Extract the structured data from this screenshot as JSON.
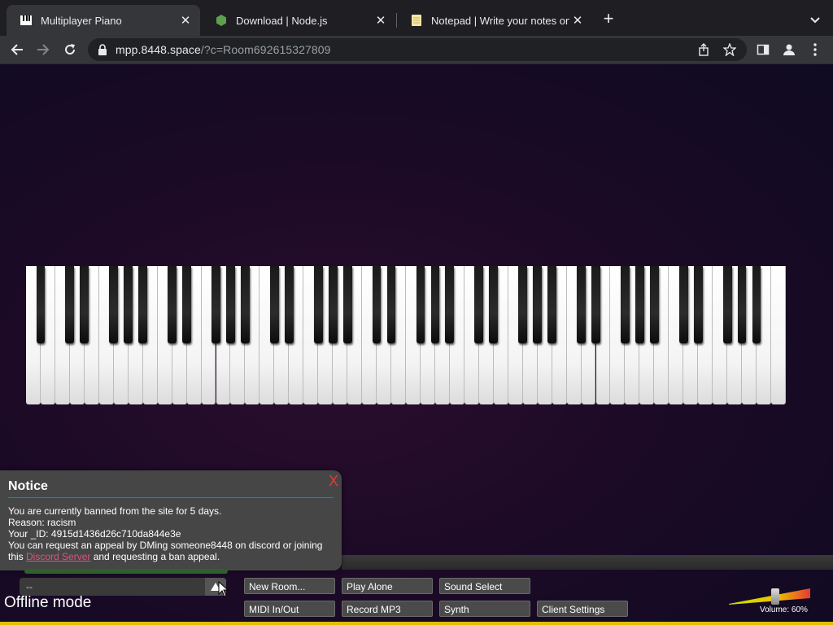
{
  "browser": {
    "tabs": [
      {
        "title": "Multiplayer Piano",
        "icon": "piano-icon",
        "active": true
      },
      {
        "title": "Download | Node.js",
        "icon": "nodejs-icon",
        "active": false
      },
      {
        "title": "Notepad | Write your notes onli",
        "icon": "notepad-icon",
        "active": false
      }
    ],
    "url_host": "mpp.8448.space",
    "url_path": "/?c=Room692615327809"
  },
  "notice": {
    "title": "Notice",
    "close": "X",
    "line1": "You are currently banned from the site for 5 days.",
    "line2": "Reason: racism",
    "line3": "Your _ID: 4915d1436d26c710da844e3e",
    "line4": "You can request an appeal by DMing someone8448 on discord or joining",
    "line5_prefix": "this ",
    "line5_link": "Discord Server",
    "line5_suffix": " and requesting a ban appeal."
  },
  "chat": {
    "value": "--"
  },
  "status": {
    "offline": "Offline mode"
  },
  "buttons": {
    "new_room": "New Room...",
    "play_alone": "Play Alone",
    "sound_select": "Sound Select",
    "midi": "MIDI In/Out",
    "record": "Record MP3",
    "synth": "Synth",
    "client_settings": "Client Settings"
  },
  "volume": {
    "label": "Volume: 60%",
    "level": 0.6
  },
  "piano": {
    "white_keys": 52
  },
  "colors": {
    "accent_red": "#e53935",
    "link": "#e0527a",
    "notice_bg": "#464646"
  }
}
